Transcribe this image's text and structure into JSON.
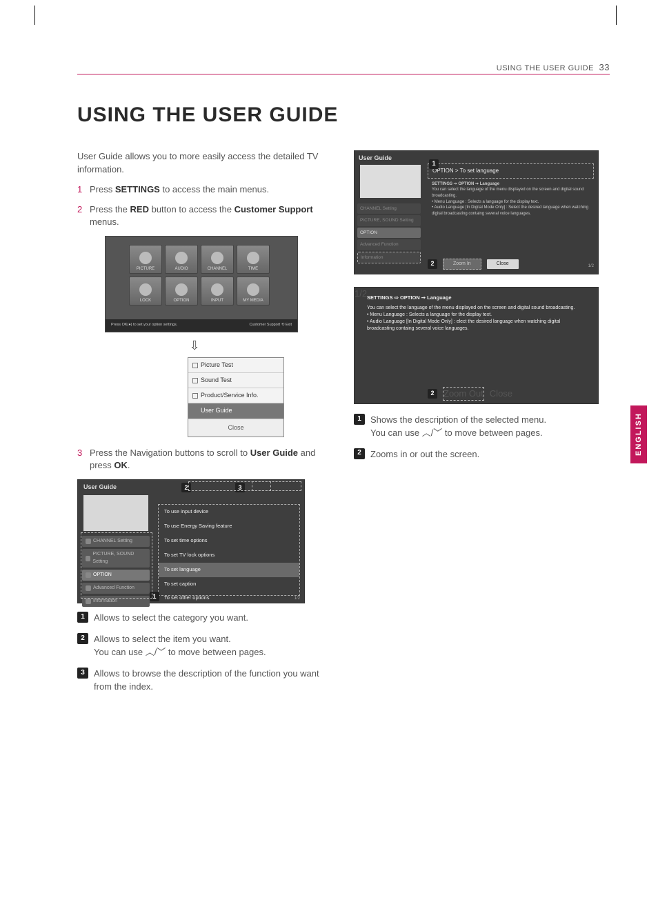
{
  "header": {
    "section": "USING THE USER GUIDE",
    "page": "33"
  },
  "title": "USING THE USER GUIDE",
  "intro": "User Guide allows you to more easily access the detailed TV information.",
  "steps": {
    "s1": {
      "n": "1",
      "pre": "Press ",
      "b1": "SETTINGS",
      "post": " to access the main menus."
    },
    "s2": {
      "n": "2",
      "pre": "Press the ",
      "b1": "RED",
      "mid": " button to access the ",
      "b2": "Customer Support",
      "post": " menus."
    },
    "s3": {
      "n": "3",
      "pre": "Press the Navigation buttons to scroll to ",
      "b1": "User Guide",
      "mid": " and press ",
      "b2": "OK",
      "post": "."
    }
  },
  "settingsGrid": {
    "row1": [
      "PICTURE",
      "AUDIO",
      "CHANNEL",
      "TIME"
    ],
    "row2": [
      "LOCK",
      "OPTION",
      "INPUT",
      "MY MEDIA"
    ],
    "hint": "Press OK(●) to set your option settings.",
    "hintR": "Customer Support   ⟲ Exit"
  },
  "popup": {
    "i1": "Picture Test",
    "i2": "Sound Test",
    "i3": "Product/Service Info.",
    "i4": "User Guide",
    "close": "Close"
  },
  "ug": {
    "title": "User Guide",
    "side": [
      "CHANNEL Setting",
      "PICTURE, SOUND Setting",
      "OPTION",
      "Advanced Function",
      "Information"
    ],
    "sideSel": 2,
    "list": [
      "To use input device",
      "To use Energy Saving feature",
      "To set time options",
      "To set TV lock options",
      "To set language",
      "To set caption",
      "To set other options"
    ],
    "listSel": 4,
    "page": "1/2"
  },
  "legendL": {
    "l1": "Allows to select the category you want.",
    "l2a": "Allows to select the item you want.",
    "l2b": "You can use ︿/﹀ to move between pages.",
    "l3a": "Allows to browse the description of the function you want from the index.",
    "n1": "1",
    "n2": "2",
    "n3": "3"
  },
  "ugR": {
    "title": "User Guide",
    "mainHdr": "OPTION > To set language",
    "crumb": "SETTINGS ➙ OPTION ➙ Language",
    "line1": "You can select the language of the menu displayed on the screen and digital sound broadcasting.",
    "b1": "Menu Language : Selects a language for the display text.",
    "b2": "Audio Language [In Digital Mode Only] : Select the desired language when watching digital broadcasting containg several voice languages.",
    "zoom": "Zoom In",
    "close": "Close",
    "page": "1/2",
    "side": [
      "CHANNEL Setting",
      "PICTURE, SOUND Setting",
      "OPTION",
      "Advanced Function",
      "Information"
    ]
  },
  "ugR2": {
    "crumb": "SETTINGS ⇨ OPTION ➙ Language",
    "line1": "You can select the language of the menu displayed on the screen and digital sound broadcasting.",
    "b1": "Menu Language : Selects a language for the display text.",
    "b2": "Audio Language [In Digital Mode Only] : elect the desired language when watching digital broadcasting containg several voice languages.",
    "zoom": "Zoom Out",
    "close": "Close",
    "page": "1/2"
  },
  "legendR": {
    "l1a": "Shows the description of the selected menu.",
    "l1b": "You can use ︿/﹀ to move between pages.",
    "l2": "Zooms in or out the screen.",
    "n1": "1",
    "n2": "2"
  },
  "langTab": "ENGLISH",
  "callouts": {
    "c1": "1",
    "c2": "2",
    "c3": "3"
  }
}
